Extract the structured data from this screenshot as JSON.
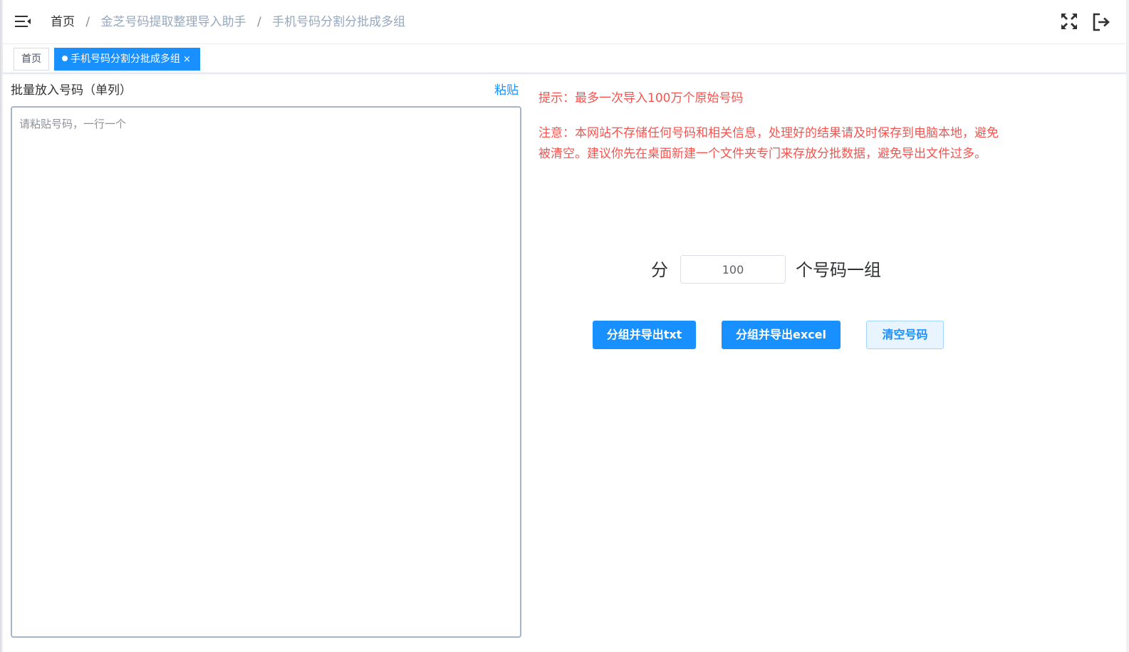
{
  "breadcrumb": {
    "home": "首页",
    "separator": "/",
    "level1": "金芝号码提取整理导入助手",
    "level2": "手机号码分割分批成多组"
  },
  "tags": {
    "home": "首页",
    "active": "手机号码分割分批成多组",
    "close": "×"
  },
  "input_panel": {
    "label": "批量放入号码（单列）",
    "paste_label": "粘贴",
    "placeholder": "请粘贴号码，一行一个",
    "value": ""
  },
  "info": {
    "hint": "提示：最多一次导入100万个原始号码",
    "notice": "注意：本网站不存储任何号码和相关信息，处理好的结果请及时保存到电脑本地，避免被清空。建议你先在桌面新建一个文件夹专门来存放分批数据，避免导出文件过多。"
  },
  "group": {
    "prefix": "分",
    "size_value": "100",
    "suffix": "个号码一组"
  },
  "buttons": {
    "export_txt": "分组并导出txt",
    "export_excel": "分组并导出excel",
    "clear": "清空号码"
  },
  "colors": {
    "primary": "#1890ff",
    "warning_text": "#f4544f",
    "breadcrumb_muted": "#97a8be"
  }
}
